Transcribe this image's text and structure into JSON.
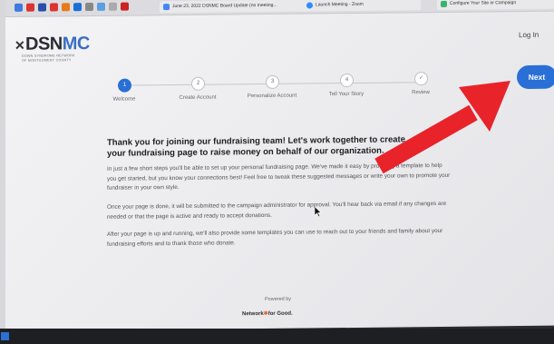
{
  "tabs": [
    {
      "title": "June 23, 2022 DSNMC Board Update (no meeting..."
    },
    {
      "title": "Launch Meeting - Zoom"
    },
    {
      "title": "Configure Your Site or Campaign"
    }
  ],
  "header": {
    "logo_prefix": "DSN",
    "logo_suffix": "MC",
    "logo_sub_line1": "DOWN SYNDROME NETWORK",
    "logo_sub_line2": "OF MONTGOMERY COUNTY",
    "login_label": "Log In"
  },
  "stepper": {
    "steps": [
      {
        "number": "1",
        "label": "Welcome"
      },
      {
        "number": "2",
        "label": "Create Account"
      },
      {
        "number": "3",
        "label": "Personalize Account"
      },
      {
        "number": "4",
        "label": "Tell Your Story"
      },
      {
        "number": "✓",
        "label": "Review"
      }
    ]
  },
  "next_label": "Next",
  "content": {
    "heading": "Thank you for joining our fundraising team! Let's work together to create your fundraising page to raise money on behalf of our organization.",
    "paragraph1": "In just a few short steps you'll be able to set up your personal fundraising page. We've made it easy by providing a template to help you get started, but you know your connections best! Feel free to tweak these suggested messages or write your own to promote your fundraiser in your own style.",
    "paragraph2": "Once your page is done, it will be submitted to the campaign administrator for approval. You'll hear back via email if any changes are needed or that the page is active and ready to accept donations.",
    "paragraph3": "After your page is up and running, we'll also provide some templates you can use to reach out to your friends and family about your fundraising efforts and to thank those who donate."
  },
  "footer": {
    "powered_by": "Powered by",
    "brand_left": "Network",
    "brand_right": "for Good."
  },
  "colors": {
    "accent": "#2a6fd6",
    "logo_accent": "#3b6fc4",
    "annotation_arrow": "#e8232a"
  }
}
